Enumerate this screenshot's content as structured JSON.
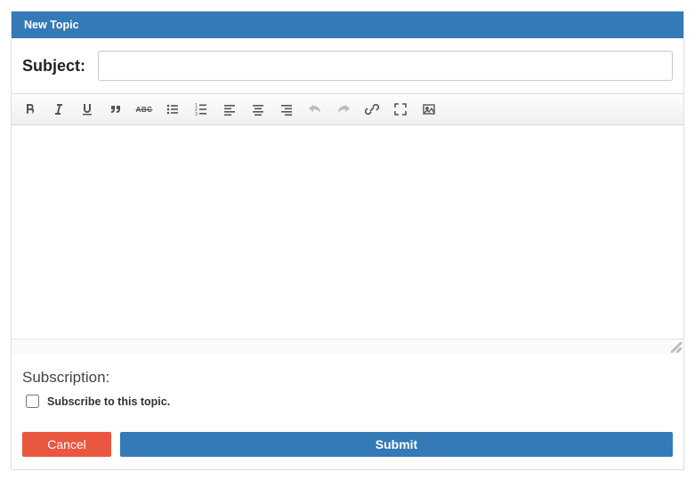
{
  "header": {
    "title": "New Topic"
  },
  "subject": {
    "label": "Subject:",
    "value": ""
  },
  "editor": {
    "value": ""
  },
  "subscription": {
    "title": "Subscription:",
    "checkbox_label": "Subscribe to this topic.",
    "checked": false
  },
  "buttons": {
    "cancel": "Cancel",
    "submit": "Submit"
  },
  "toolbar": {
    "items": [
      {
        "name": "bold-icon"
      },
      {
        "name": "italic-icon"
      },
      {
        "name": "underline-icon"
      },
      {
        "name": "quote-icon"
      },
      {
        "name": "strikethrough-icon"
      },
      {
        "name": "unordered-list-icon"
      },
      {
        "name": "ordered-list-icon"
      },
      {
        "name": "align-left-icon"
      },
      {
        "name": "align-center-icon"
      },
      {
        "name": "align-right-icon"
      },
      {
        "name": "undo-icon"
      },
      {
        "name": "redo-icon"
      },
      {
        "name": "link-icon"
      },
      {
        "name": "fullscreen-icon"
      },
      {
        "name": "image-icon"
      }
    ]
  }
}
